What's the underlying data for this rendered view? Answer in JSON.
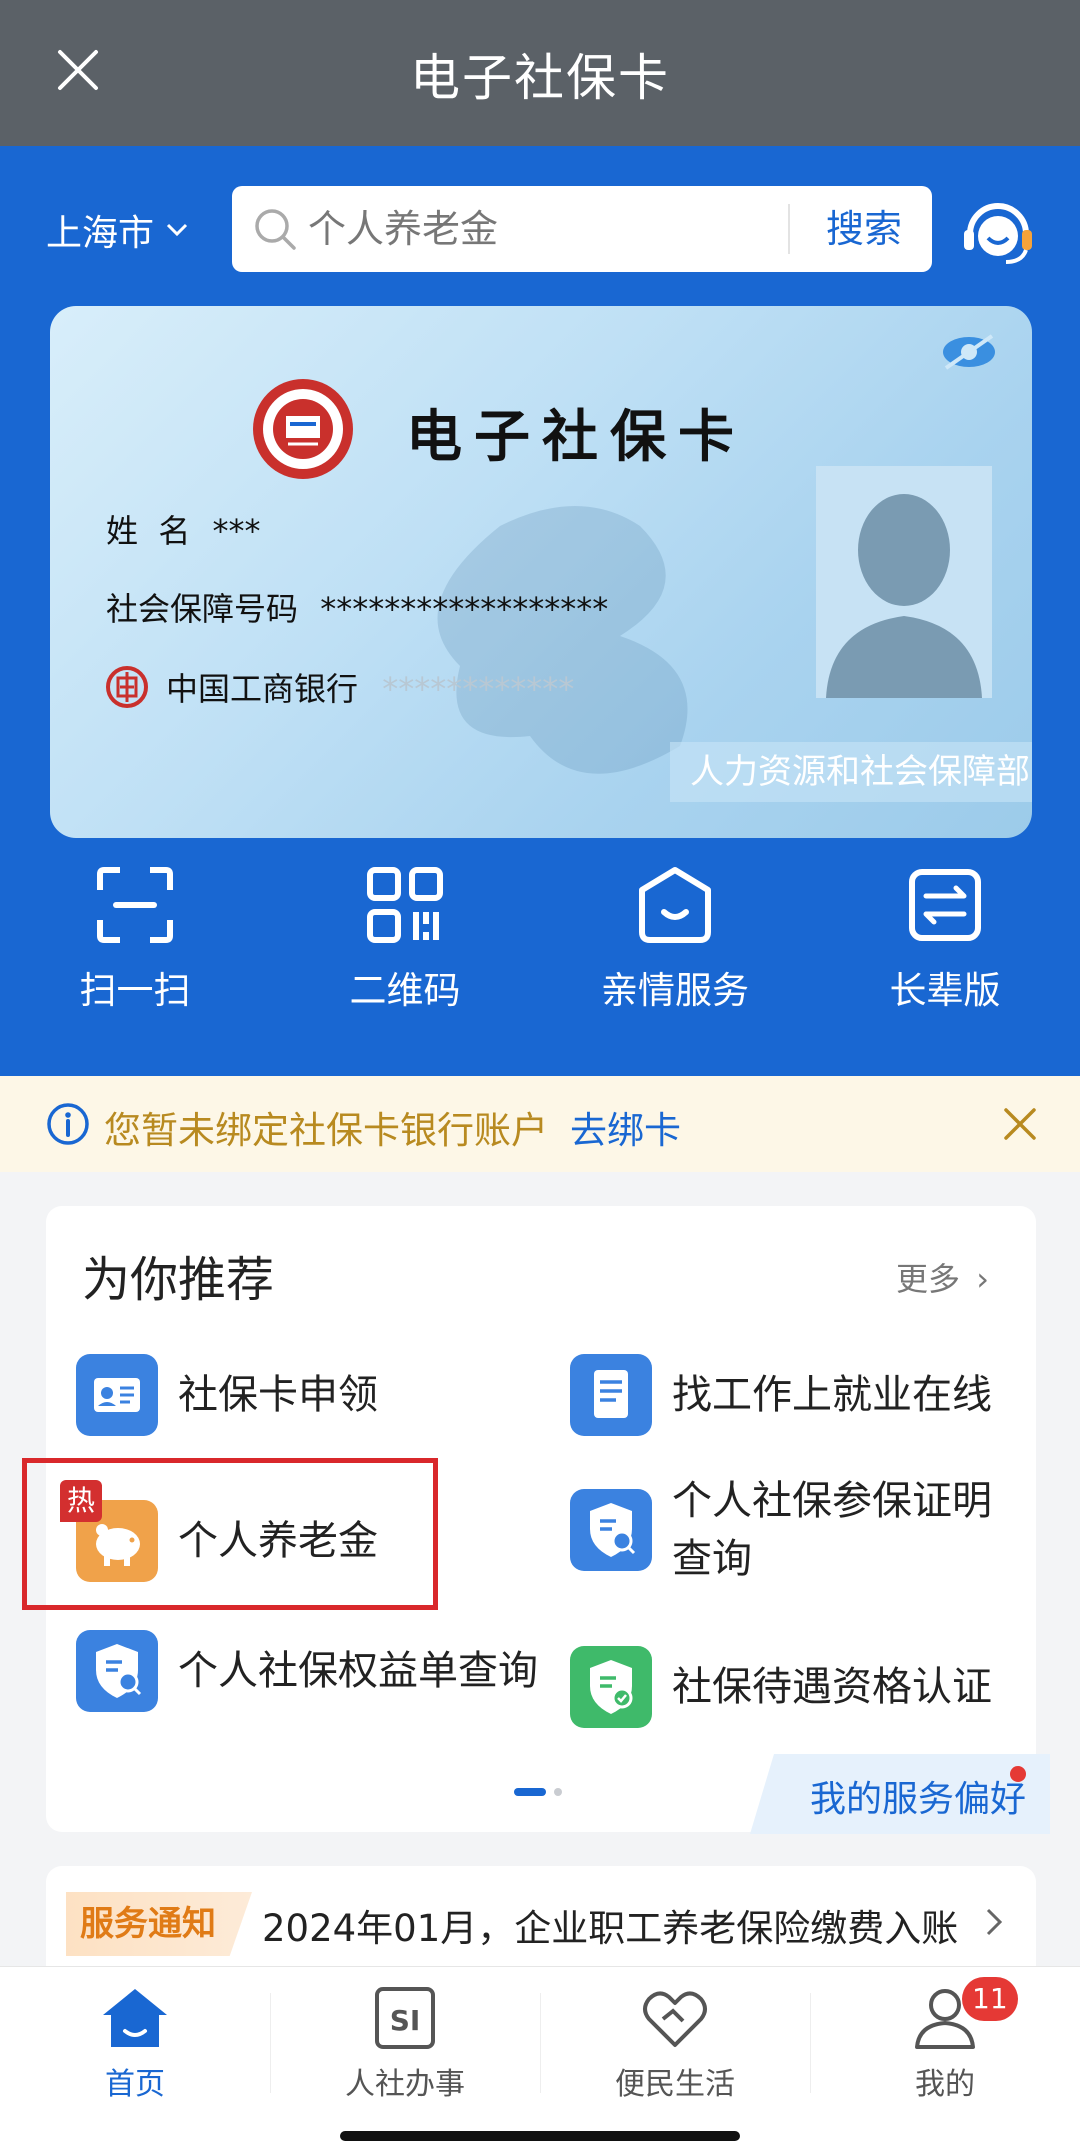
{
  "titlebar": {
    "title": "电子社保卡"
  },
  "header": {
    "city": "上海市",
    "search_placeholder": "个人养老金",
    "search_button": "搜索"
  },
  "card": {
    "title": "电子社保卡",
    "name_label": "姓  名",
    "name_value": "***",
    "ssn_label": "社会保障号码",
    "ssn_value": "******************",
    "bank_name": "中国工商银行",
    "bank_account": "************",
    "issuer": "人力资源和社会保障部"
  },
  "quick_actions": [
    {
      "label": "扫一扫",
      "icon": "scan-icon"
    },
    {
      "label": "二维码",
      "icon": "qrcode-icon"
    },
    {
      "label": "亲情服务",
      "icon": "family-service-icon"
    },
    {
      "label": "长辈版",
      "icon": "elder-mode-icon"
    }
  ],
  "notice": {
    "text": "您暂未绑定社保卡银行账户",
    "link": "去绑卡"
  },
  "recommend": {
    "title": "为你推荐",
    "more": "更多",
    "items": [
      {
        "label": "社保卡申领",
        "icon": "id-card-icon",
        "color": "#3b82e0"
      },
      {
        "label": "找工作上就业在线",
        "icon": "document-icon",
        "color": "#3b82e0"
      },
      {
        "label": "个人养老金",
        "icon": "piggy-bank-icon",
        "color": "#f0a24a",
        "hot": "热"
      },
      {
        "label": "个人社保参保证明查询",
        "icon": "shield-search-icon",
        "color": "#3b82e0"
      },
      {
        "label": "个人社保权益单查询",
        "icon": "shield-search-icon",
        "color": "#3b82e0"
      },
      {
        "label": "社保待遇资格认证",
        "icon": "shield-check-icon",
        "color": "#3fba6a"
      }
    ],
    "preference": "我的服务偏好"
  },
  "service_notice": {
    "tag": "服务通知",
    "text": "2024年01月，企业职工养老保险缴费入账"
  },
  "bottom_nav": [
    {
      "label": "首页",
      "icon": "home-icon",
      "active": true
    },
    {
      "label": "人社办事",
      "icon": "si-icon"
    },
    {
      "label": "便民生活",
      "icon": "heart-hand-icon"
    },
    {
      "label": "我的",
      "icon": "user-icon",
      "badge": "11"
    }
  ],
  "colors": {
    "primary": "#1967d2",
    "titlebar": "#5b6167",
    "hot": "#d32f2f",
    "notice_text": "#b88a20"
  }
}
